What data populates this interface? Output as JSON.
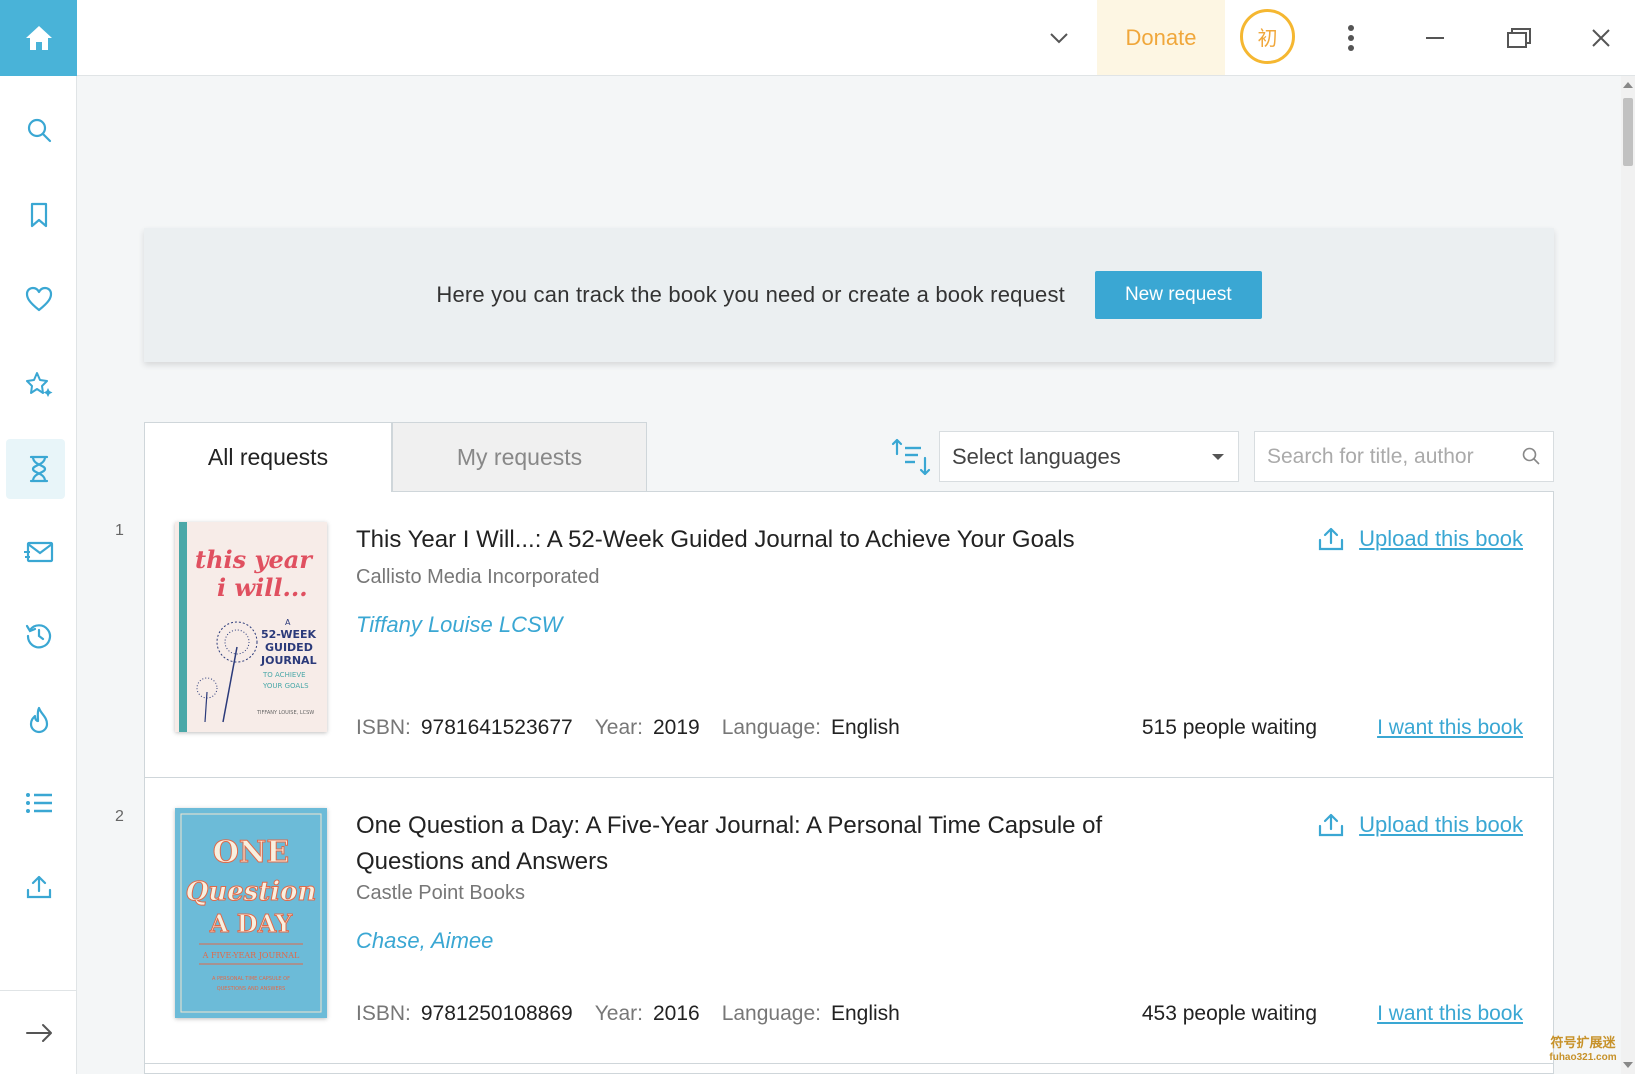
{
  "topbar": {
    "donate_label": "Donate",
    "avatar_initial": "初"
  },
  "sidebar": {
    "items": [
      {
        "name": "search-icon",
        "active": false
      },
      {
        "name": "bookmark-icon",
        "active": false
      },
      {
        "name": "heart-icon",
        "active": false
      },
      {
        "name": "sparkle-star-icon",
        "active": false
      },
      {
        "name": "hourglass-icon",
        "active": true
      },
      {
        "name": "mail-icon",
        "active": false
      },
      {
        "name": "history-icon",
        "active": false
      },
      {
        "name": "flame-icon",
        "active": false
      },
      {
        "name": "list-icon",
        "active": false
      },
      {
        "name": "upload-icon",
        "active": false
      }
    ],
    "collapse": "arrow-right-icon"
  },
  "banner": {
    "text": "Here you can track the book you need or create a book request",
    "button_label": "New request"
  },
  "tabs": {
    "all": "All requests",
    "my": "My requests",
    "active": "All requests"
  },
  "filters": {
    "language_placeholder": "Select languages",
    "search_placeholder": "Search for title, author"
  },
  "labels": {
    "isbn": "ISBN:",
    "year": "Year:",
    "language": "Language:",
    "upload": "Upload this book",
    "want": "I want this book"
  },
  "books": [
    {
      "index": "1",
      "title": "This Year I Will...: A 52-Week Guided Journal to Achieve Your Goals",
      "publisher": "Callisto Media Incorporated",
      "author": "Tiffany Louise LCSW",
      "isbn": "9781641523677",
      "year": "2019",
      "language": "English",
      "waiting": "515 people waiting",
      "cover": {
        "line1": "this year",
        "line2": "i will...",
        "sub1": "A",
        "sub2": "52-WEEK",
        "sub3": "GUIDED",
        "sub4": "JOURNAL",
        "sub5": "TO ACHIEVE",
        "sub6": "YOUR GOALS",
        "byline": "TIFFANY LOUISE, LCSW"
      }
    },
    {
      "index": "2",
      "title": "One Question a Day: A Five-Year Journal: A Personal Time Capsule of Questions and Answers",
      "publisher": "Castle Point Books",
      "author": "Chase, Aimee",
      "isbn": "9781250108869",
      "year": "2016",
      "language": "English",
      "waiting": "453 people waiting",
      "cover": {
        "line1": "ONE",
        "line2": "Question",
        "line3": "A DAY",
        "sub1": "A FIVE-YEAR JOURNAL",
        "sub2": "A PERSONAL TIME CAPSULE OF",
        "sub3": "QUESTIONS AND ANSWERS"
      }
    }
  ],
  "colors": {
    "accent": "#3aa7d3",
    "home": "#49b3d8",
    "donate_text": "#f0a73b",
    "donate_bg": "#fdf6e3"
  },
  "watermark": {
    "line1": "符号扩展迷",
    "line2": "fuhao321.com"
  }
}
